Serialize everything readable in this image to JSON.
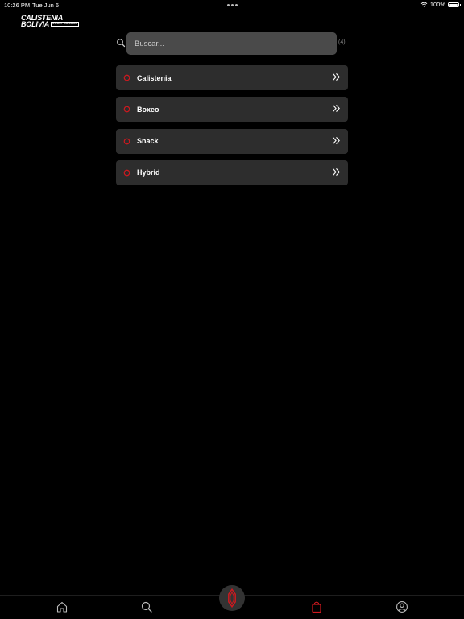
{
  "status_bar": {
    "time": "10:26 PM",
    "date": "Tue Jun 6",
    "battery": "100%",
    "wifi_icon": "wifi-icon"
  },
  "logo": {
    "line1": "CALISTENIA",
    "line2": "BOLIVIA",
    "sub": "STREET WORKOUT",
    "icon": "calistenia-logo-mark"
  },
  "search": {
    "placeholder": "Buscar...",
    "value": "",
    "count": "(4)",
    "icon": "search-icon"
  },
  "categories": [
    {
      "label": "Calistenia",
      "icon": "ring-icon",
      "arrow": "double-chevron-right-icon"
    },
    {
      "label": "Boxeo",
      "icon": "ring-icon",
      "arrow": "double-chevron-right-icon"
    },
    {
      "label": "Snack",
      "icon": "ring-icon",
      "arrow": "double-chevron-right-icon"
    },
    {
      "label": "Hybrid",
      "icon": "ring-icon",
      "arrow": "double-chevron-right-icon"
    }
  ],
  "bottom_nav": {
    "items": [
      "home-icon",
      "search-icon",
      "logo-mark-icon",
      "shopping-bag-icon",
      "profile-icon"
    ],
    "active": "shopping-bag-icon"
  },
  "colors": {
    "background": "#000000",
    "card": "#2d2d2d",
    "search_bg": "#4a4a4a",
    "accent": "#d0191f",
    "muted": "#8a8a8a"
  }
}
